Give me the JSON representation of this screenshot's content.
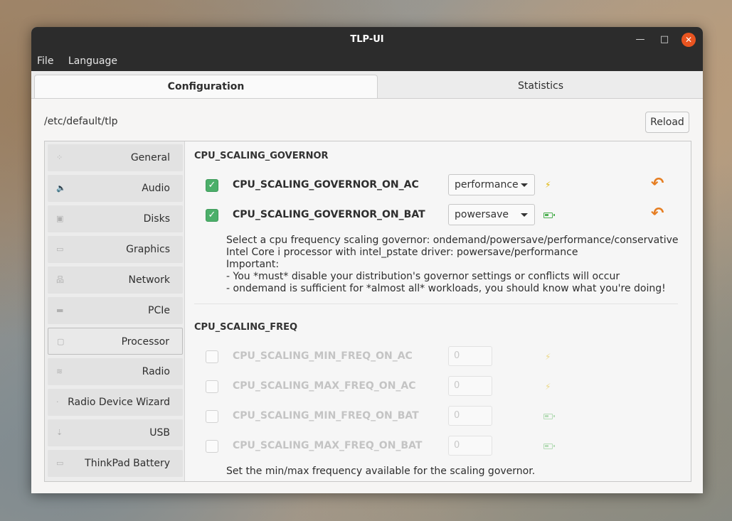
{
  "window": {
    "title": "TLP-UI"
  },
  "window_controls": {
    "minimize": "—",
    "maximize": "□",
    "close": "✕"
  },
  "menubar": {
    "items": [
      "File",
      "Language"
    ]
  },
  "tabs": [
    {
      "label": "Configuration",
      "active": true
    },
    {
      "label": "Statistics",
      "active": false
    }
  ],
  "config_path": "/etc/default/tlp",
  "reload_label": "Reload",
  "sidebar": {
    "items": [
      {
        "label": "General",
        "icon": "grid-icon"
      },
      {
        "label": "Audio",
        "icon": "speaker-icon"
      },
      {
        "label": "Disks",
        "icon": "disk-icon"
      },
      {
        "label": "Graphics",
        "icon": "monitor-icon"
      },
      {
        "label": "Network",
        "icon": "network-icon"
      },
      {
        "label": "PCIe",
        "icon": "pcie-icon"
      },
      {
        "label": "Processor",
        "icon": "processor-icon",
        "selected": true
      },
      {
        "label": "Radio",
        "icon": "wifi-icon"
      },
      {
        "label": "Radio Device Wizard",
        "icon": "wizard-icon"
      },
      {
        "label": "USB",
        "icon": "usb-icon"
      },
      {
        "label": "ThinkPad Battery",
        "icon": "battery-icon"
      }
    ]
  },
  "governor_section": {
    "title": "CPU_SCALING_GOVERNOR",
    "params": [
      {
        "name": "CPU_SCALING_GOVERNOR_ON_AC",
        "checked": true,
        "value": "performance",
        "power": "ac"
      },
      {
        "name": "CPU_SCALING_GOVERNOR_ON_BAT",
        "checked": true,
        "value": "powersave",
        "power": "battery"
      }
    ],
    "description": [
      "Select a cpu frequency scaling governor: ondemand/powersave/performance/conservative",
      "Intel Core i processor with intel_pstate driver: powersave/performance",
      "Important:",
      "- You *must* disable your distribution's governor settings or conflicts will occur",
      "- ondemand is sufficient for *almost all* workloads, you should know what you're doing!"
    ]
  },
  "freq_section": {
    "title": "CPU_SCALING_FREQ",
    "params": [
      {
        "name": "CPU_SCALING_MIN_FREQ_ON_AC",
        "checked": false,
        "value": "0",
        "power": "ac"
      },
      {
        "name": "CPU_SCALING_MAX_FREQ_ON_AC",
        "checked": false,
        "value": "0",
        "power": "ac"
      },
      {
        "name": "CPU_SCALING_MIN_FREQ_ON_BAT",
        "checked": false,
        "value": "0",
        "power": "battery"
      },
      {
        "name": "CPU_SCALING_MAX_FREQ_ON_BAT",
        "checked": false,
        "value": "0",
        "power": "battery"
      }
    ],
    "description": [
      "Set the min/max frequency available for the scaling governor."
    ]
  },
  "colors": {
    "accent": "#e95420",
    "checked": "#4caf6a",
    "revert": "#e67e22",
    "ac_bolt": "#e0b400",
    "battery": "#4caf50"
  }
}
